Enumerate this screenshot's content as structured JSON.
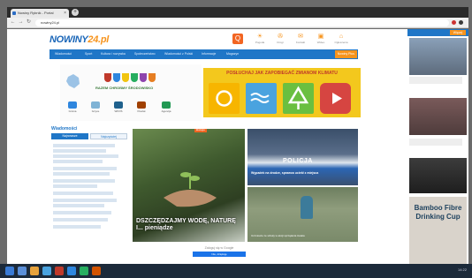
{
  "browser": {
    "tab_title": "Nowiny Rybnik - Portal",
    "url": "nowiny24.pl",
    "new_tab_glyph": "+",
    "close_glyph": "×"
  },
  "site": {
    "logo_main": "NOWINY",
    "logo_accent": "24.pl",
    "search_glyph": "Q",
    "top_icons": [
      {
        "icon": "sun-icon",
        "glyph": "☀",
        "label": "Pogoda"
      },
      {
        "icon": "car-icon",
        "glyph": "✇",
        "label": "Drogi"
      },
      {
        "icon": "bell-icon",
        "glyph": "✉",
        "label": "Kontakt"
      },
      {
        "icon": "tv-icon",
        "glyph": "▣",
        "label": "Wideo"
      },
      {
        "icon": "house-icon",
        "glyph": "⌂",
        "label": "Ogłoszenia"
      }
    ],
    "nav": [
      "Wiadomości",
      "Sport",
      "Kultura i rozrywka",
      "Społeczeństwo",
      "Wiadomości z Polski",
      "Informacje",
      "Magazyn"
    ],
    "nav_cta": "Nowiny Plus"
  },
  "banner": {
    "title": "RAZEM CHROŃMY ŚRODOWISKO",
    "headline": "POSŁUCHAJ JAK ZAPOBIEGAĆ ZMIANOM KLIMATU",
    "partners": [
      "Gmina",
      "Gzyce",
      "WFOŚ",
      "Powiat",
      "Agencja"
    ],
    "tile_colors": [
      "#f7b500",
      "#4aa3df",
      "#6abf40",
      "#d64541"
    ]
  },
  "left": {
    "heading": "Wiadomości",
    "tab_a": "Najnowsze",
    "tab_b": "Najczęściej"
  },
  "hero": {
    "badge": "Ekologia",
    "caption": "DSZCZĘDZAJMY WODĘ, NATURĘ I... pieniądze"
  },
  "police": {
    "label": "POLICJA",
    "caption": "Wypadek na drodze, sprawca uciekł z miejsca"
  },
  "kid": {
    "caption": "Uczniowie ze szkoły w akcji sprzątania świata"
  },
  "right": {
    "top_btn": "Więcej",
    "ad_text": "Bamboo Fibre Drinking Cup"
  },
  "footer": {
    "signin": "Zaloguj się w Google",
    "signin_btn": "Nie, dziękuję"
  },
  "taskbar": {
    "clock": "14:22"
  }
}
